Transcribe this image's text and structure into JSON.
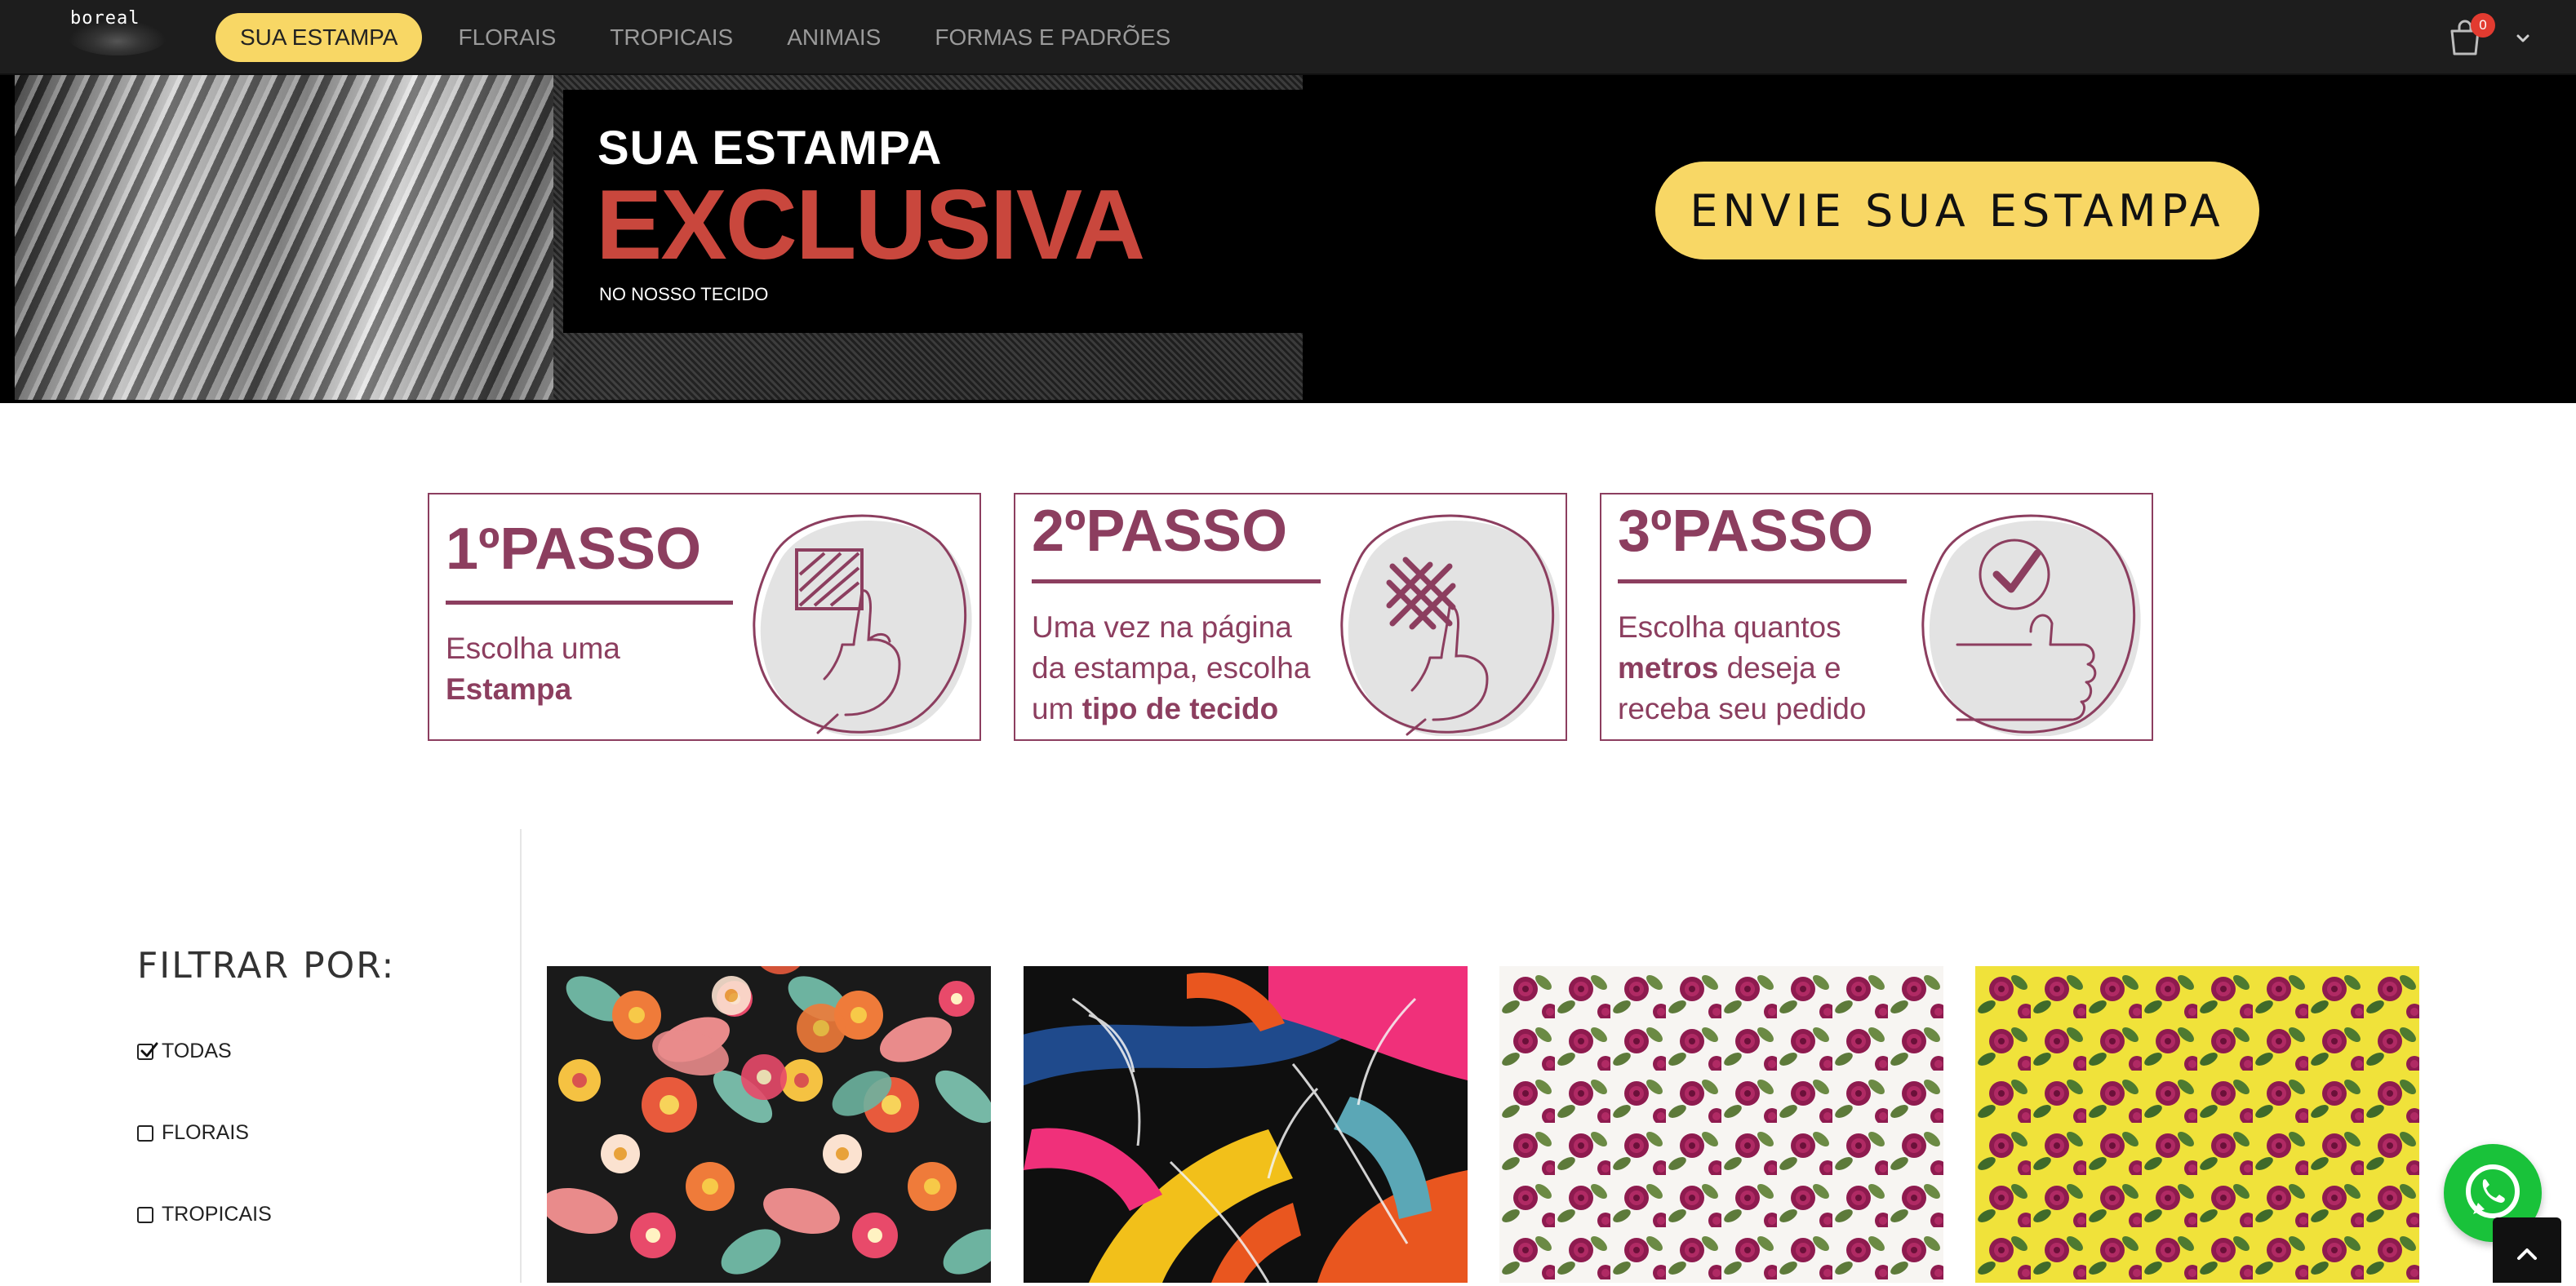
{
  "brand": {
    "logo_text": "boreal"
  },
  "nav": {
    "items": [
      {
        "label": "SUA ESTAMPA",
        "active": true
      },
      {
        "label": "FLORAIS",
        "active": false
      },
      {
        "label": "TROPICAIS",
        "active": false
      },
      {
        "label": "ANIMAIS",
        "active": false
      },
      {
        "label": "FORMAS E PADRÕES",
        "active": false
      }
    ],
    "cart_count": "0",
    "cart_icon": "shopping-bag-icon",
    "dropdown_icon": "chevron-down-icon"
  },
  "hero": {
    "line1": "SUA ESTAMPA",
    "line2": "EXCLUSIVA",
    "line3": "NO NOSSO TECIDO",
    "cta_label": "ENVIE SUA ESTAMPA"
  },
  "steps": [
    {
      "title": "1ºPASSO",
      "desc_plain": "Escolha uma",
      "desc_bold": "Estampa",
      "icon": "hand-pattern-icon"
    },
    {
      "title": "2ºPASSO",
      "desc_plain": "Uma vez na página da estampa, escolha um",
      "desc_bold": "tipo de tecido",
      "icon": "hand-weave-icon"
    },
    {
      "title": "3ºPASSO",
      "desc_plain_before": "Escolha quantos",
      "desc_bold": "metros",
      "desc_plain_after": "deseja e receba seu pedido",
      "icon": "thumbs-up-check-icon"
    }
  ],
  "filter": {
    "title": "FILTRAR POR:",
    "options": [
      {
        "label": "TODAS",
        "checked": true
      },
      {
        "label": "FLORAIS",
        "checked": false
      },
      {
        "label": "TROPICAIS",
        "checked": false
      }
    ]
  },
  "products": [
    {
      "pattern": "colorful-floral-on-black"
    },
    {
      "pattern": "tropical-brushstrokes"
    },
    {
      "pattern": "magenta-roses-on-white"
    },
    {
      "pattern": "magenta-roses-on-yellow"
    }
  ],
  "floating": {
    "whatsapp_icon": "whatsapp-icon",
    "back_to_top_icon": "chevron-up-icon"
  },
  "colors": {
    "accent_yellow": "#f8d765",
    "brand_wine": "#8c3e5f",
    "hero_red": "#c9473d",
    "nav_bg": "#1d1d1d",
    "whatsapp_green": "#19c23a",
    "badge_red": "#e23b30"
  }
}
